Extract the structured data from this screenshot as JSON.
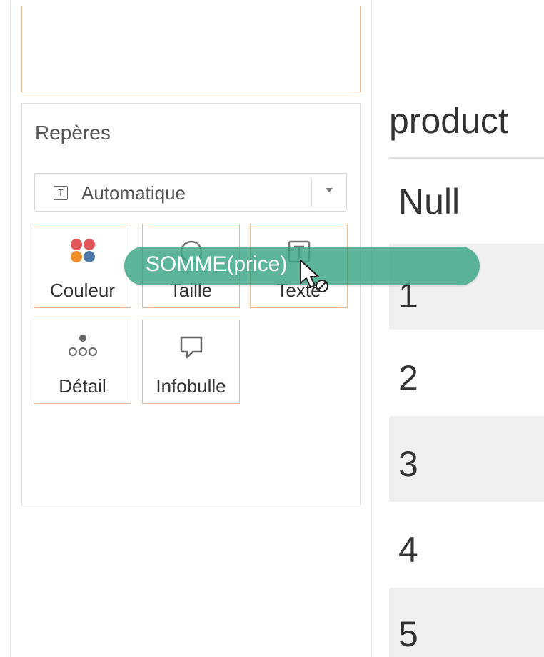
{
  "marks": {
    "title": "Repères",
    "mark_type": {
      "label": "Automatique",
      "icon": "T"
    },
    "shelves": [
      {
        "label": "Couleur",
        "icon": "color-dots-icon"
      },
      {
        "label": "Taille",
        "icon": "size-circle-icon"
      },
      {
        "label": "Texte",
        "icon": "text-icon"
      },
      {
        "label": "Détail",
        "icon": "detail-dots-icon"
      },
      {
        "label": "Infobulle",
        "icon": "tooltip-icon"
      }
    ],
    "colors": {
      "red": "#e15759",
      "orange": "#f28e2b",
      "blue": "#4e79a7",
      "purple": "#b07aa1"
    }
  },
  "drag": {
    "pill_label": "SOMME(price)",
    "pill_color": "#38a482"
  },
  "table": {
    "header": "product",
    "rows": [
      "Null",
      "1",
      "2",
      "3",
      "4",
      "5"
    ]
  }
}
